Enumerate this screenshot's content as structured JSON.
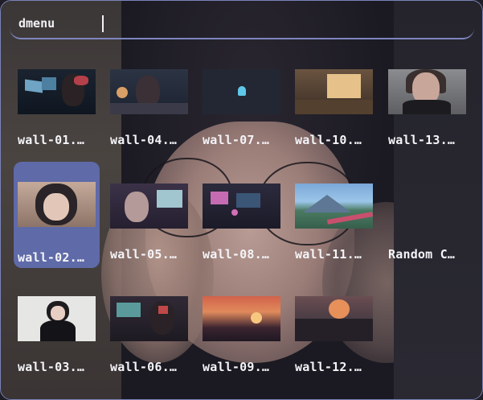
{
  "app": {
    "prompt": "dmenu",
    "search": {
      "value": "",
      "placeholder": ""
    }
  },
  "grid": {
    "items": [
      {
        "label": "wall-01.…",
        "thumb": "wall-01",
        "selected": false
      },
      {
        "label": "wall-04.…",
        "thumb": "wall-04",
        "selected": false
      },
      {
        "label": "wall-07.…",
        "thumb": "wall-07",
        "selected": false
      },
      {
        "label": "wall-10.…",
        "thumb": "wall-10",
        "selected": false
      },
      {
        "label": "wall-13.…",
        "thumb": "wall-13",
        "selected": false
      },
      {
        "label": "wall-02.…",
        "thumb": "wall-02",
        "selected": true
      },
      {
        "label": "wall-05.…",
        "thumb": "wall-05",
        "selected": false
      },
      {
        "label": "wall-08.…",
        "thumb": "wall-08",
        "selected": false
      },
      {
        "label": "wall-11.…",
        "thumb": "wall-11",
        "selected": false
      },
      {
        "label": "Random C…",
        "thumb": "random",
        "selected": false
      },
      {
        "label": "wall-03.…",
        "thumb": "wall-03",
        "selected": false
      },
      {
        "label": "wall-06.…",
        "thumb": "wall-06",
        "selected": false
      },
      {
        "label": "wall-09.…",
        "thumb": "wall-09",
        "selected": false
      },
      {
        "label": "wall-12.…",
        "thumb": "wall-12",
        "selected": false
      }
    ]
  },
  "colors": {
    "accent": "#7e86c0",
    "selection": "#5f6aa8",
    "text": "#f4f4f8",
    "background": "#1f1e26"
  }
}
